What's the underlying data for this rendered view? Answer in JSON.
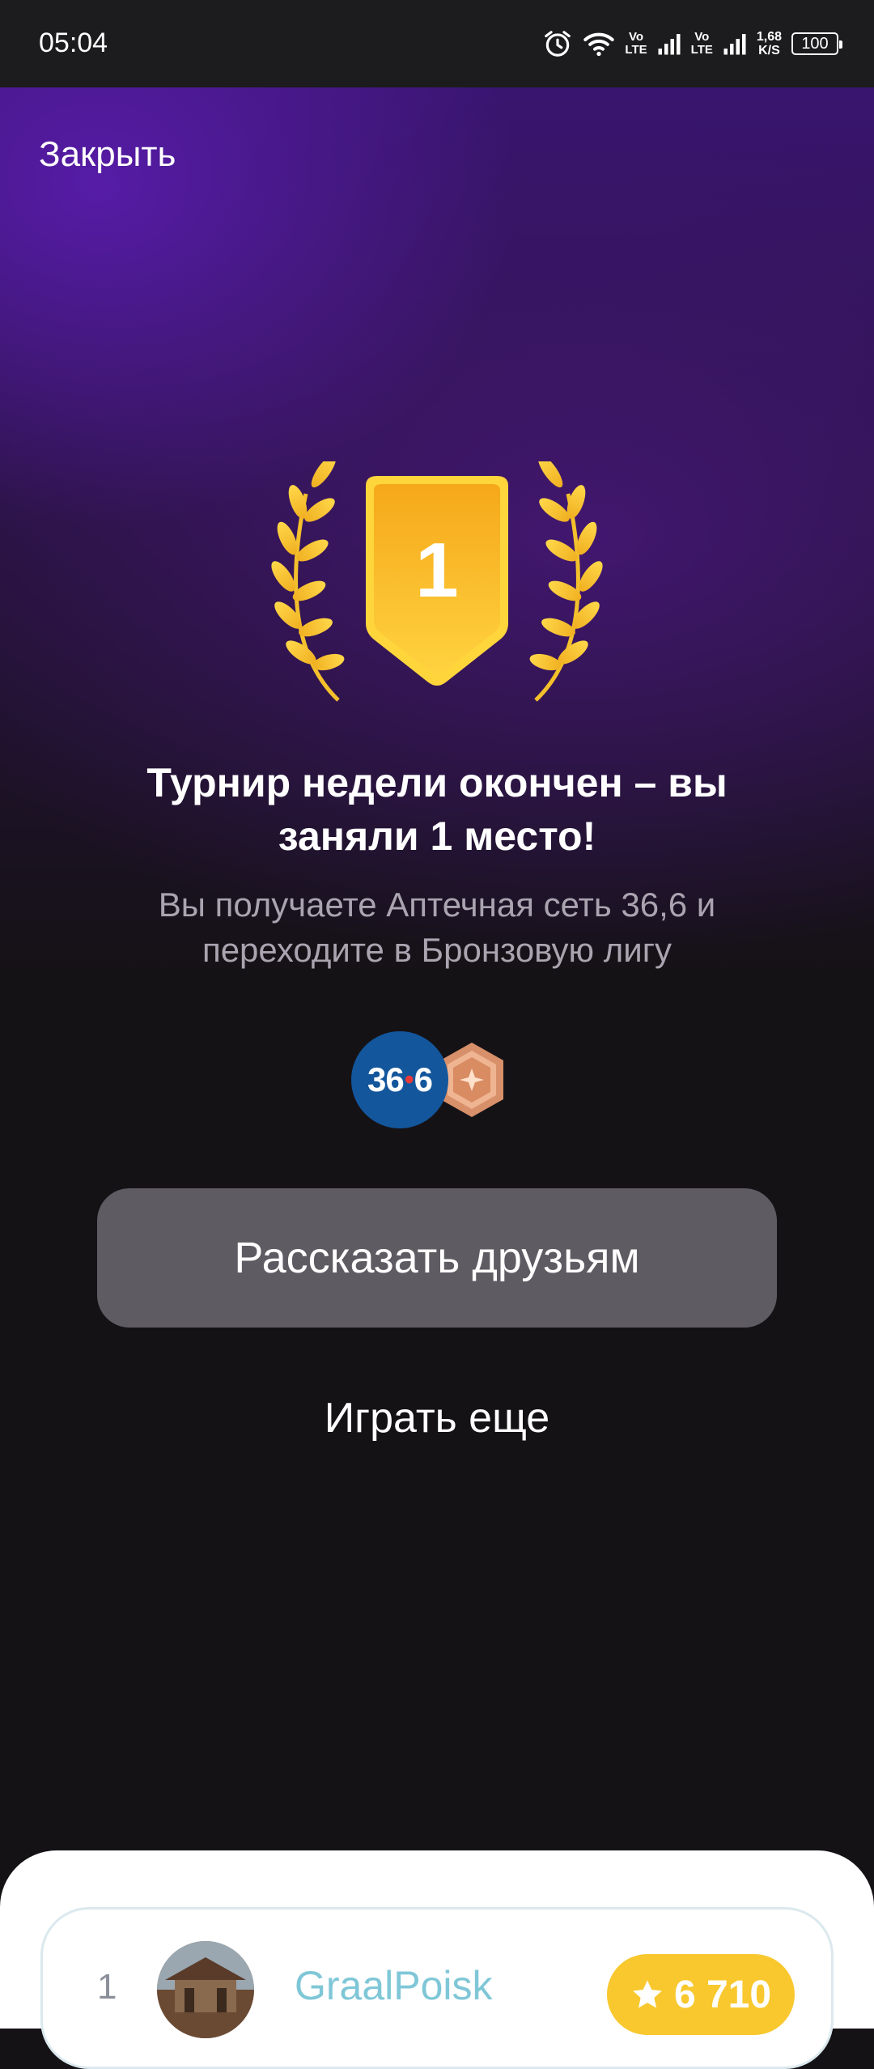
{
  "status_bar": {
    "time": "05:04",
    "network_1": [
      "Vo",
      "LTE"
    ],
    "network_2": [
      "Vo",
      "LTE"
    ],
    "speed_value": "1,68",
    "speed_unit": "K/S",
    "battery": "100",
    "icons": [
      "alarm-icon",
      "wifi-icon",
      "signal-icon",
      "signal-icon",
      "battery-icon"
    ]
  },
  "header": {
    "close_label": "Закрыть"
  },
  "result": {
    "place": "1",
    "title": "Турнир недели окончен – вы заняли 1 место!",
    "subtitle": "Вы получаете Аптечная сеть 36,6 и переходите в Бронзовую лигу",
    "reward_logo_text_a": "36",
    "reward_logo_text_b": "6",
    "colors": {
      "accent_gold": "#f8c82e",
      "reward_blue": "#13569c",
      "bronze": "#d7906a"
    }
  },
  "actions": {
    "share_label": "Рассказать друзьям",
    "play_again_label": "Играть еще"
  },
  "leaderboard": {
    "rows": [
      {
        "rank": "1",
        "name": "GraalPoisk",
        "score": "6 710"
      }
    ]
  }
}
